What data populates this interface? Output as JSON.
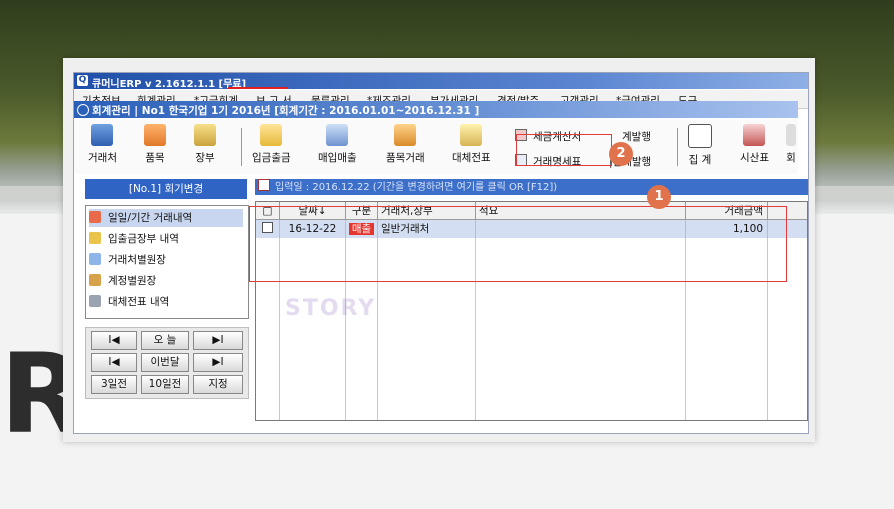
{
  "app": {
    "title": "큐머니ERP   v 2.1612.1.1 [무료]"
  },
  "menu": [
    "기초정보",
    "회계관리",
    "*고급회계",
    "보 고 서",
    "물류관리",
    "*제조관리",
    "부가세관리",
    "견적/발주",
    "고객관리",
    "*급여관리",
    "도구"
  ],
  "window": {
    "subtitle": "회계관리 | No1 한국기업 1기 2016년 [회계기간 : 2016.01.01~2016.12.31 ]"
  },
  "toolbar": {
    "buttons": [
      "거래처",
      "품목",
      "장부",
      "입금출금",
      "매입매출",
      "품목거래",
      "대체전표",
      "집 계",
      "시산표",
      "회"
    ],
    "small": [
      "세금계산서",
      "계발행",
      "거래명세표",
      "|집계발행"
    ]
  },
  "left": {
    "header": "[No.1] 회기변경",
    "items": [
      "일일/기간 거래내역",
      "입출금장부 내역",
      "거래처별원장",
      "계정별원장",
      "대체전표 내역"
    ],
    "nav": [
      "I◀",
      "오 늘",
      "▶I",
      "I◀",
      "이번달",
      "▶I",
      "3일전",
      "10일전",
      "지정"
    ]
  },
  "right": {
    "info": "입력일 : 2016.12.22  (기간을 변경하려면 여기를 클릭 OR [F12])",
    "columns": [
      "□",
      "날짜↓",
      "구분",
      "거래처,장부",
      "적요",
      "거래금액"
    ],
    "rows": [
      {
        "date": "16-12-22",
        "type": "매출",
        "partner": "일반거래처",
        "memo": "",
        "amount": "1,100"
      }
    ]
  },
  "annotations": {
    "badge1": "1",
    "badge2": "2"
  },
  "watermark": "STORY",
  "colors": {
    "titlebar": "#1f4fa8",
    "selected": "#c8d6ef",
    "annotation": "#e03c3c",
    "badge": "#e0734b"
  }
}
